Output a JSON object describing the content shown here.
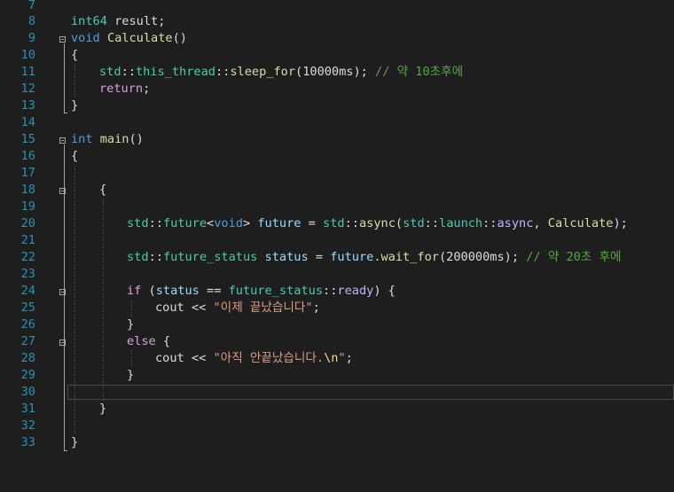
{
  "editor": {
    "line_numbers": [
      "7",
      "8",
      "9",
      "10",
      "11",
      "12",
      "13",
      "14",
      "15",
      "16",
      "17",
      "18",
      "19",
      "20",
      "21",
      "22",
      "23",
      "24",
      "25",
      "26",
      "27",
      "28",
      "29",
      "30",
      "31",
      "32",
      "33"
    ],
    "lines": {
      "l8": {
        "t1": "int64",
        "t2": " result;"
      },
      "l9": {
        "t1": "void",
        "t2": " ",
        "t3": "Calculate",
        "t4": "()"
      },
      "l10": {
        "t1": "{"
      },
      "l11": {
        "t1": "std",
        "t2": "::",
        "t3": "this_thread",
        "t4": "::",
        "t5": "sleep_for",
        "t6": "(10000ms); ",
        "t7": "// 약 10초후에"
      },
      "l12": {
        "t1": "return",
        "t2": ";"
      },
      "l13": {
        "t1": "}"
      },
      "l15": {
        "t1": "int",
        "t2": " ",
        "t3": "main",
        "t4": "()"
      },
      "l16": {
        "t1": "{"
      },
      "l18": {
        "t1": "{"
      },
      "l20": {
        "t1": "std",
        "t2": "::",
        "t3": "future",
        "t4": "<",
        "t5": "void",
        "t6": "> ",
        "t7": "future",
        "t8": " = ",
        "t9": "std",
        "t10": "::",
        "t11": "async",
        "t12": "(",
        "t13": "std",
        "t14": "::",
        "t15": "launch",
        "t16": "::",
        "t17": "async",
        "t18": ", ",
        "t19": "Calculate",
        "t20": ");"
      },
      "l22": {
        "t1": "std",
        "t2": "::",
        "t3": "future_status",
        "t4": " ",
        "t5": "status",
        "t6": " = ",
        "t7": "future",
        "t8": ".",
        "t9": "wait_for",
        "t10": "(200000ms); ",
        "t11": "// 약 20초 후에"
      },
      "l24": {
        "t1": "if",
        "t2": " (",
        "t3": "status",
        "t4": " == ",
        "t5": "future_status",
        "t6": "::",
        "t7": "ready",
        "t8": ") {"
      },
      "l25": {
        "t1": "cout",
        "t2": " << ",
        "t3": "\"이제 끝났습니다\"",
        "t4": ";"
      },
      "l26": {
        "t1": "}"
      },
      "l27": {
        "t1": "else",
        "t2": " {"
      },
      "l28": {
        "t1": "cout",
        "t2": " << ",
        "t3": "\"아직 안끝났습니다.",
        "t4": "\\n",
        "t5": "\"",
        "t6": ";"
      },
      "l29": {
        "t1": "}"
      },
      "l31": {
        "t1": "}"
      },
      "l33": {
        "t1": "}"
      }
    }
  }
}
